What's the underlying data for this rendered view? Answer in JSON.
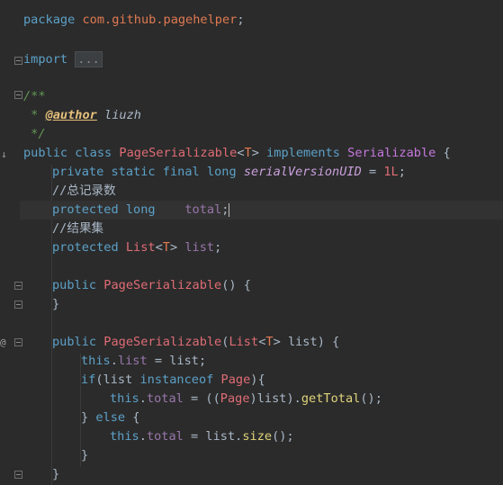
{
  "code": {
    "package_kw": "package",
    "package_name": "com.github.pagehelper",
    "semicolon": ";",
    "import_kw": "import",
    "import_fold": "...",
    "doc_open": "/**",
    "doc_star": " * ",
    "doc_tag": "@author",
    "doc_author": " liuzh",
    "doc_close": " */",
    "public": "public",
    "class": "class",
    "class_name": "PageSerializable",
    "type_param_open": "<",
    "type_param": "T",
    "type_param_close": ">",
    "implements": "implements",
    "serializable": "Serializable",
    "brace_open": "{",
    "brace_close": "}",
    "private": "private",
    "static": "static",
    "final": "final",
    "long": "long",
    "serial_field": "serialVersionUID",
    "eq": " = ",
    "serial_value": "1L",
    "comment_total": "//总记录数",
    "protected": "protected",
    "total": "total",
    "comment_list": "//结果集",
    "list_type": "List",
    "list": "list",
    "ctor_empty_params": "() {",
    "ctor_param_type": "List",
    "ctor_param_name": "list",
    "this": "this",
    "if": "if",
    "instanceof": "instanceof",
    "page": "Page",
    "get_total": "getTotal",
    "else": "else",
    "size": "size"
  }
}
